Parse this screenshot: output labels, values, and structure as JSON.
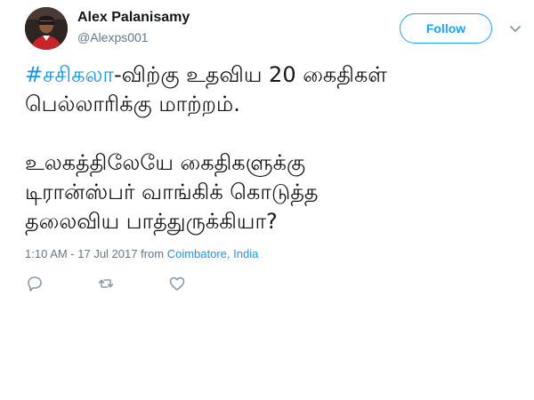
{
  "author": {
    "display_name": "Alex Palanisamy",
    "handle": "@Alexps001",
    "avatar_icon": "user-avatar"
  },
  "follow_button": {
    "label": "Follow"
  },
  "menu_icon": "chevron-down-icon",
  "tweet": {
    "hashtag": "#சசிகலா",
    "line1_rest": "-விற்கு உதவிய 20 கைதிகள்",
    "line2": "பெல்லாரிக்கு மாற்றம்.",
    "line3": "உலகத்திலேயே கைதிகளுக்கு",
    "line4": "டிரான்ஸ்பர் வாங்கிக் கொடுத்த",
    "line5": "தலைவிய பாத்துருக்கியா?"
  },
  "meta": {
    "timestamp": "1:10 AM - 17 Jul 2017 from ",
    "location": "Coimbatore, India"
  },
  "actions": [
    "reply-icon",
    "retweet-icon",
    "like-icon"
  ],
  "colors": {
    "accent": "#1da1f2",
    "link": "#1b95e0",
    "muted": "#657786",
    "text": "#14171a"
  }
}
